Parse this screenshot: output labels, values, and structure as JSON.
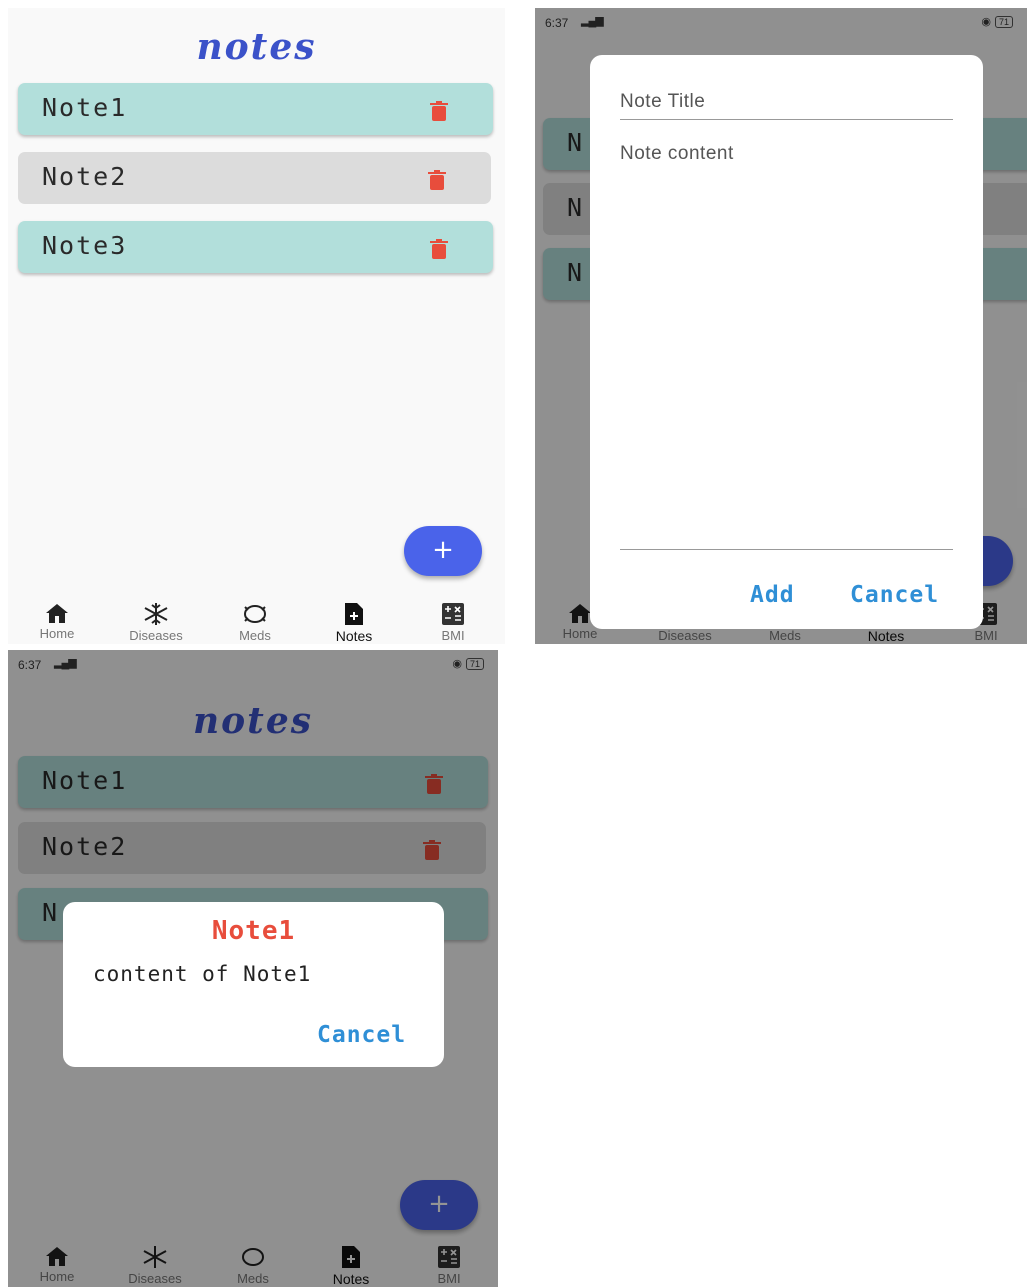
{
  "status": {
    "time": "6:37",
    "signal": "    ",
    "battery": "71"
  },
  "app": {
    "title": "notes"
  },
  "notes": [
    {
      "label": "Note1",
      "color": "#b2dfdb"
    },
    {
      "label": "Note2",
      "color": "#dcdcdc"
    },
    {
      "label": "Note3",
      "color": "#b2dfdb"
    }
  ],
  "notes_partial": {
    "n1": "N",
    "n2": "N",
    "n3": "N"
  },
  "fab": {
    "label": "+"
  },
  "nav": [
    {
      "label": "Home",
      "icon": "home-icon"
    },
    {
      "label": "Diseases",
      "icon": "snowflake-icon"
    },
    {
      "label": "Meds",
      "icon": "pill-icon"
    },
    {
      "label": "Notes",
      "icon": "note-add-icon",
      "active": true
    },
    {
      "label": "BMI",
      "icon": "calculator-icon"
    }
  ],
  "add_dialog": {
    "title_placeholder": "Note Title",
    "content_placeholder": "Note content",
    "add_label": "Add",
    "cancel_label": "Cancel"
  },
  "view_dialog": {
    "title": "Note1",
    "content": "content of Note1",
    "cancel_label": "Cancel"
  },
  "colors": {
    "accent": "#3b52c9",
    "fab": "#4a63ea",
    "delete": "#e84d3c",
    "dialog_button": "#2f8fd6"
  }
}
